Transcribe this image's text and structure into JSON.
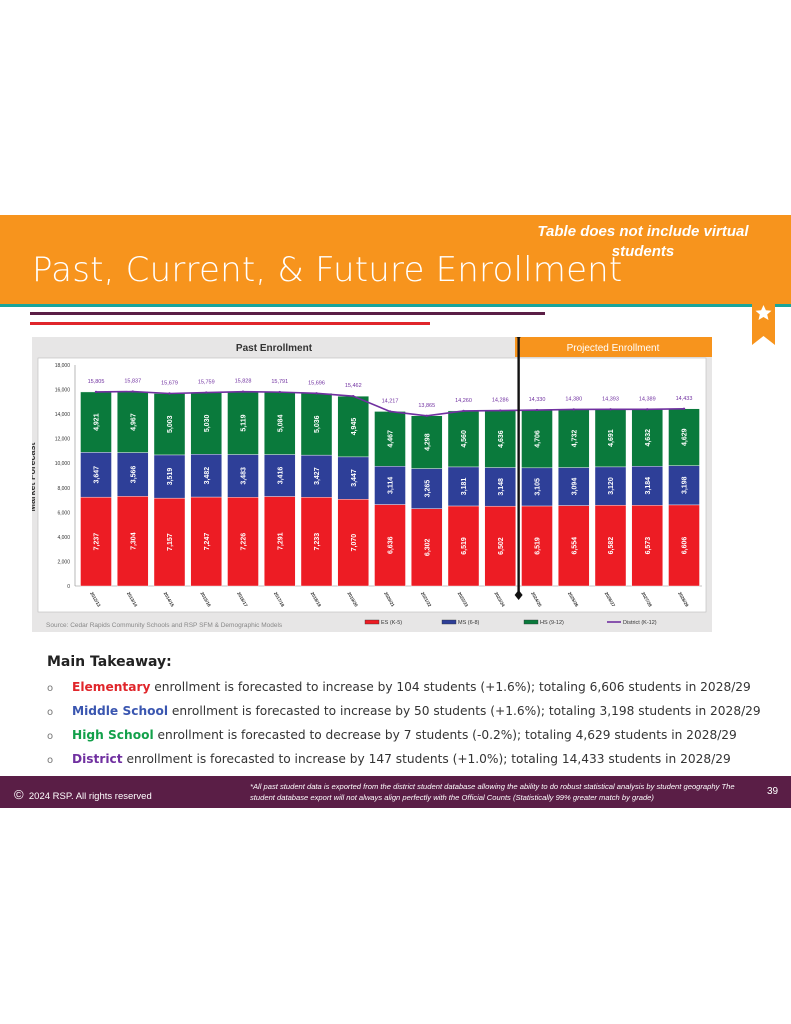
{
  "header": {
    "title": "Past, Current, & Future Enrollment",
    "note": "Table does not include virtual students"
  },
  "colors": {
    "orange": "#F7941D",
    "teal": "#1AA59A",
    "purple": "#5A1E46",
    "red": "#E0262B",
    "es": "#ED1C24",
    "ms": "#2E3F98",
    "hs": "#0A7A3C",
    "district": "#7030A0"
  },
  "icons": {
    "ribbon": "star-ribbon-icon",
    "copyright": "copyright-icon"
  },
  "chart_data": {
    "type": "bar",
    "stacked": true,
    "sections": {
      "past": "Past Enrollment",
      "projected": "Projected Enrollment"
    },
    "ylabel": "Market Forecast",
    "ylim": [
      0,
      18000
    ],
    "yticks": [
      "0",
      "2,000",
      "4,000",
      "6,000",
      "8,000",
      "10,000",
      "12,000",
      "14,000",
      "16,000",
      "18,000"
    ],
    "categories": [
      "2012/13",
      "2013/14",
      "2014/15",
      "2015/16",
      "2016/17",
      "2017/18",
      "2018/19",
      "2019/20",
      "2020/21",
      "2021/22",
      "2022/23",
      "2023/24",
      "2024/25",
      "2025/26",
      "2026/27",
      "2027/28",
      "2028/29"
    ],
    "series": [
      {
        "name": "ES (K-5)",
        "color": "#ED1C24",
        "values": [
          7237,
          7304,
          7157,
          7247,
          7226,
          7291,
          7233,
          7070,
          6636,
          6302,
          6519,
          6502,
          6519,
          6554,
          6582,
          6573,
          6606
        ]
      },
      {
        "name": "MS (6-8)",
        "color": "#2E3F98",
        "values": [
          3647,
          3566,
          3519,
          3482,
          3483,
          3416,
          3427,
          3447,
          3114,
          3265,
          3181,
          3148,
          3105,
          3094,
          3120,
          3184,
          3198
        ]
      },
      {
        "name": "HS (9-12)",
        "color": "#0A7A3C",
        "values": [
          4921,
          4967,
          5003,
          5030,
          5119,
          5084,
          5036,
          4945,
          4467,
          4298,
          4560,
          4636,
          4706,
          4732,
          4691,
          4632,
          4629
        ]
      }
    ],
    "line": {
      "name": "District (K-12)",
      "color": "#7030A0",
      "values": [
        15805,
        15837,
        15679,
        15759,
        15828,
        15791,
        15696,
        15462,
        14217,
        13865,
        14260,
        14286,
        14330,
        14380,
        14393,
        14389,
        14433
      ]
    },
    "divider_after": "2023/24",
    "legend": "bottom",
    "source": "Source:  Cedar Rapids Community Schools and RSP SFM & Demographic Models"
  },
  "takeaway": {
    "heading": "Main Takeaway:",
    "items": [
      {
        "lead": "Elementary",
        "color": "#E0262B",
        "text": " enrollment is forecasted to increase by 104 students (+1.6%); totaling 6,606 students in 2028/29"
      },
      {
        "lead": "Middle School",
        "color": "#3A56B0",
        "text": " enrollment is forecasted to increase by 50 students (+1.6%); totaling 3,198 students in 2028/29"
      },
      {
        "lead": "High School",
        "color": "#12A04A",
        "text": " enrollment is forecasted to decrease by 7 students (-0.2%); totaling 4,629 students in 2028/29"
      },
      {
        "lead": "District",
        "color": "#7030A0",
        "text": " enrollment is forecasted to increase by 147 students (+1.0%); totaling 14,433 students in 2028/29"
      }
    ],
    "bullet": "o"
  },
  "footer": {
    "copyright": "2024 RSP. All rights reserved",
    "disclaimer": "*All past student data is exported from the district student database allowing the ability to do robust statistical analysis by student geography The student database export will not always align perfectly with the Official Counts (Statistically 99% greater match by grade)",
    "page": "39"
  }
}
